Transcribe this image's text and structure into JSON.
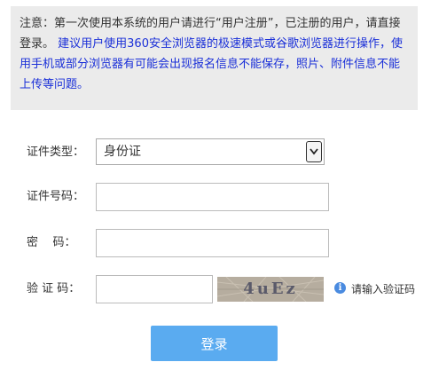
{
  "notice": {
    "intro": "注意：第一次使用本系统的用户请进行“用户注册”，已注册的用户，请直接登录。",
    "browser_tip": "建议用户使用360安全浏览器的极速模式或谷歌浏览器进行操作，使用手机或部分浏览器有可能会出现报名信息不能保存，照片、附件信息不能上传等问题。"
  },
  "form": {
    "id_type_label": "证件类型：",
    "id_type_value": "身份证",
    "id_number_label": "证件号码：",
    "password_label": "密    码：",
    "captcha_label": "验 证 码：",
    "captcha_image_text": "4uEz",
    "captcha_hint": "请输入验证码",
    "submit_label": "登录"
  },
  "icons": {
    "dropdown": "chevron-down-icon",
    "hint": "info-icon"
  },
  "colors": {
    "notice_bg": "#ebebeb",
    "notice_link_text": "#1a2fd8",
    "button_bg": "#5aabf0",
    "hint_icon": "#4a8be0"
  }
}
